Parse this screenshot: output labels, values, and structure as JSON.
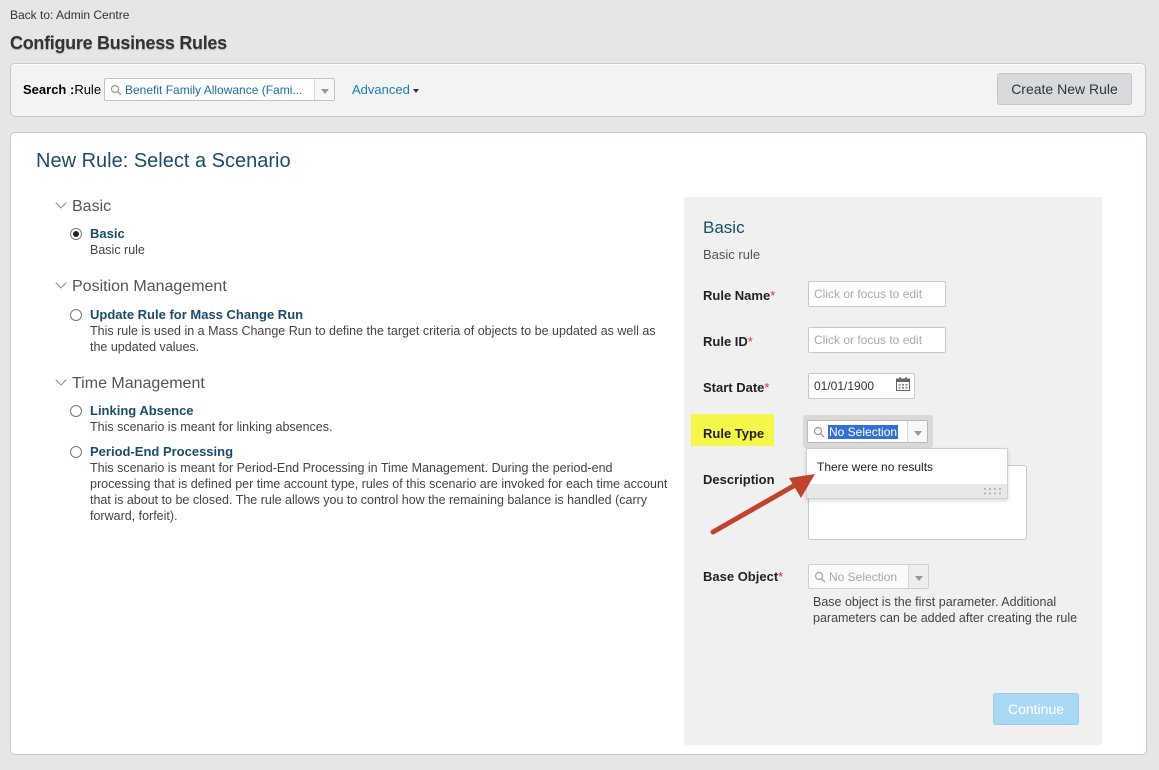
{
  "nav": {
    "back_link": "Back to: Admin Centre"
  },
  "page": {
    "title": "Configure Business Rules"
  },
  "search": {
    "label_bold": "Search :",
    "label_type": "Rule",
    "value": "Benefit Family Allowance (Fami...",
    "advanced": "Advanced",
    "create_button": "Create New Rule"
  },
  "scenario_panel": {
    "title": "New Rule: Select a Scenario",
    "groups": [
      {
        "name": "Basic",
        "items": [
          {
            "title": "Basic",
            "desc": "Basic rule",
            "selected": true
          }
        ]
      },
      {
        "name": "Position Management",
        "items": [
          {
            "title": "Update Rule for Mass Change Run",
            "desc": "This rule is used in a Mass Change Run to define the target criteria of objects to be updated as well as the updated values.",
            "selected": false
          }
        ]
      },
      {
        "name": "Time Management",
        "items": [
          {
            "title": "Linking Absence",
            "desc": "This scenario is meant for linking absences.",
            "selected": false
          },
          {
            "title": "Period-End Processing",
            "desc": "This scenario is meant for Period-End Processing in Time Management. During the period-end processing that is defined per time account type, rules of this scenario are invoked for each time account that is about to be closed. The rule allows you to control how the remaining balance is handled (carry forward, forfeit).",
            "selected": false
          }
        ]
      }
    ]
  },
  "form": {
    "title": "Basic",
    "subtitle": "Basic rule",
    "rule_name": {
      "label": "Rule Name",
      "placeholder": "Click or focus to edit"
    },
    "rule_id": {
      "label": "Rule ID",
      "placeholder": "Click or focus to edit"
    },
    "start_date": {
      "label": "Start Date",
      "value": "01/01/1900"
    },
    "rule_type": {
      "label": "Rule Type",
      "value": "No Selection",
      "dropdown_message": "There were no results"
    },
    "description": {
      "label": "Description"
    },
    "base_object": {
      "label": "Base Object",
      "value": "No Selection",
      "hint": "Base object is the first parameter. Additional parameters can be added after creating the rule"
    },
    "required_mark": "*",
    "continue_button": "Continue"
  },
  "colors": {
    "link": "#1a7fb5",
    "heading": "#1b4c6b",
    "highlight": "#f4f64a",
    "annotation_arrow": "#c0432e",
    "continue_disabled": "#a9d9f4"
  }
}
